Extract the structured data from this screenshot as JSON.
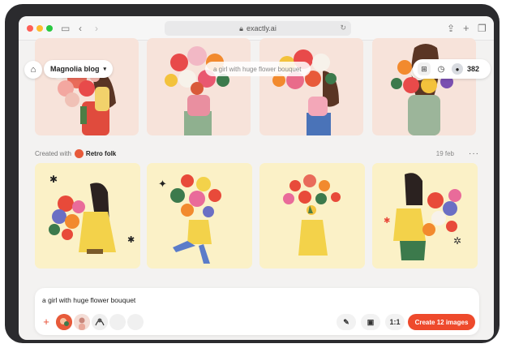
{
  "browser": {
    "url": "exactly.ai",
    "lock_icon": "lock-icon"
  },
  "header": {
    "project_name": "Magnolia blog",
    "search_placeholder": "a girl with huge flower bouquet",
    "credits": "382"
  },
  "section": {
    "created_with_label": "Created with",
    "style_name": "Retro folk",
    "date": "19 feb",
    "more_label": "···"
  },
  "prompt": {
    "text": "a girl with huge flower bouquet",
    "add_label": "+",
    "aspect_ratio": "1:1",
    "create_label": "Create 12 images"
  },
  "colors": {
    "accent": "#ee4a2c",
    "tile_top_bg": "#f7e3da",
    "tile_bottom_bg": "#fbf1c7"
  }
}
